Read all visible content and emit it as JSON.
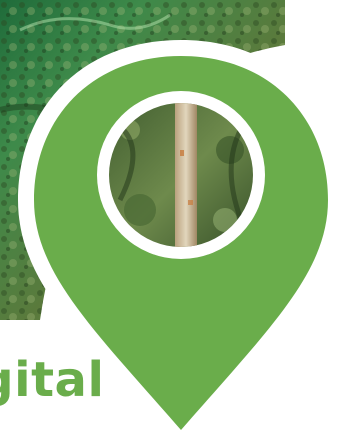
{
  "headline": {
    "text": "Digital",
    "visible_fragment": "tal"
  },
  "colors": {
    "pin_green": "#6aad4b",
    "text_green": "#6aad4b",
    "pin_ring": "#ffffff",
    "forest_dark": "#2d4a22",
    "forest_mid": "#5a7a3c",
    "forest_light": "#8fa866"
  },
  "icons": {
    "pin": "map-pin-icon",
    "photo": "forest-photo"
  }
}
